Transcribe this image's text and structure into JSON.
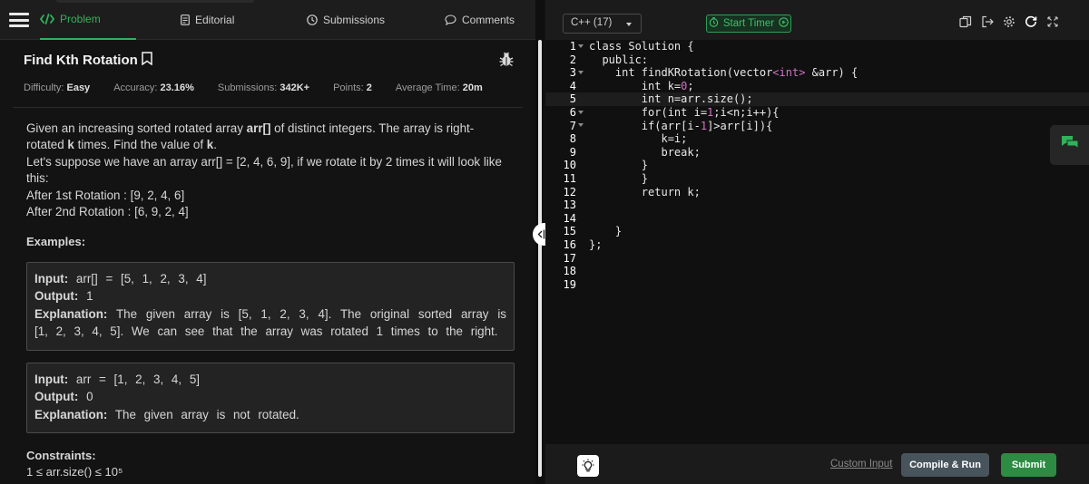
{
  "nav": {
    "tabs": [
      {
        "label": "Problem",
        "icon": "code-icon",
        "active": true
      },
      {
        "label": "Editorial",
        "icon": "document-icon"
      },
      {
        "label": "Submissions",
        "icon": "clock-icon"
      },
      {
        "label": "Comments",
        "icon": "chat-bubble-icon"
      }
    ]
  },
  "problem": {
    "title": "Find Kth Rotation",
    "meta": [
      {
        "label": "Difficulty:",
        "value": "Easy"
      },
      {
        "label": "Accuracy:",
        "value": "23.16%"
      },
      {
        "label": "Submissions:",
        "value": "342K+"
      },
      {
        "label": "Points:",
        "value": "2"
      },
      {
        "label": "Average Time:",
        "value": "20m"
      }
    ],
    "description": {
      "p1_a": "Given an increasing sorted rotated array ",
      "p1_b": "arr[]",
      "p1_c": " of distinct integers. The array is right-rotated ",
      "p1_d": "k",
      "p1_e": " times. Find the value of ",
      "p1_f": "k",
      "p1_g": ".",
      "p2": "Let's suppose we have an array arr[] = [2, 4, 6, 9], if we rotate it by 2 times it will look like this:",
      "p3": "After 1st Rotation : [9, 2, 4, 6]",
      "p4": "After 2nd Rotation : [6, 9, 2, 4]"
    },
    "examples_heading": "Examples:",
    "examples": [
      {
        "input_label": "Input:",
        "input": "arr[] = [5, 1, 2, 3, 4]",
        "output_label": "Output:",
        "output": "1",
        "explanation_label": "Explanation:",
        "explanation": "The given array is [5, 1, 2, 3, 4]. The original sorted array is [1, 2, 3, 4, 5]. We can see that the array was rotated 1 times to the right."
      },
      {
        "input_label": "Input:",
        "input": "arr = [1, 2, 3, 4, 5]",
        "output_label": "Output:",
        "output": "0",
        "explanation_label": "Explanation:",
        "explanation": "The given array is not rotated."
      }
    ],
    "constraints_heading": "Constraints:",
    "constraints_partial": "1 ≤ arr.size() ≤ 10⁵"
  },
  "editor": {
    "language": "C++ (17)",
    "timer_label": "Start Timer",
    "line_numbers": [
      "1",
      "2",
      "3",
      "4",
      "5",
      "6",
      "7",
      "8",
      "9",
      "10",
      "11",
      "12",
      "13",
      "14",
      "15",
      "16",
      "17",
      "18",
      "19"
    ],
    "code_lines": [
      "class Solution {",
      "  public:",
      "    int findKRotation(vector<int> &arr) {",
      "        int k=0;",
      "        int n=arr.size();",
      "        for(int i=1;i<n;i++){",
      "        if(arr[i-1]>arr[i]){",
      "           k=i;",
      "           break;",
      "        }",
      "        }",
      "        return k;",
      "",
      "",
      "    }",
      "};",
      "",
      "",
      ""
    ]
  },
  "footer": {
    "custom_input": "Custom Input",
    "compile_run": "Compile & Run",
    "submit": "Submit"
  },
  "colors": {
    "accent_green": "#2fb35a",
    "submit_green": "#2e8b43",
    "compile_gray": "#48545c",
    "number_pink": "#d66fc8"
  }
}
